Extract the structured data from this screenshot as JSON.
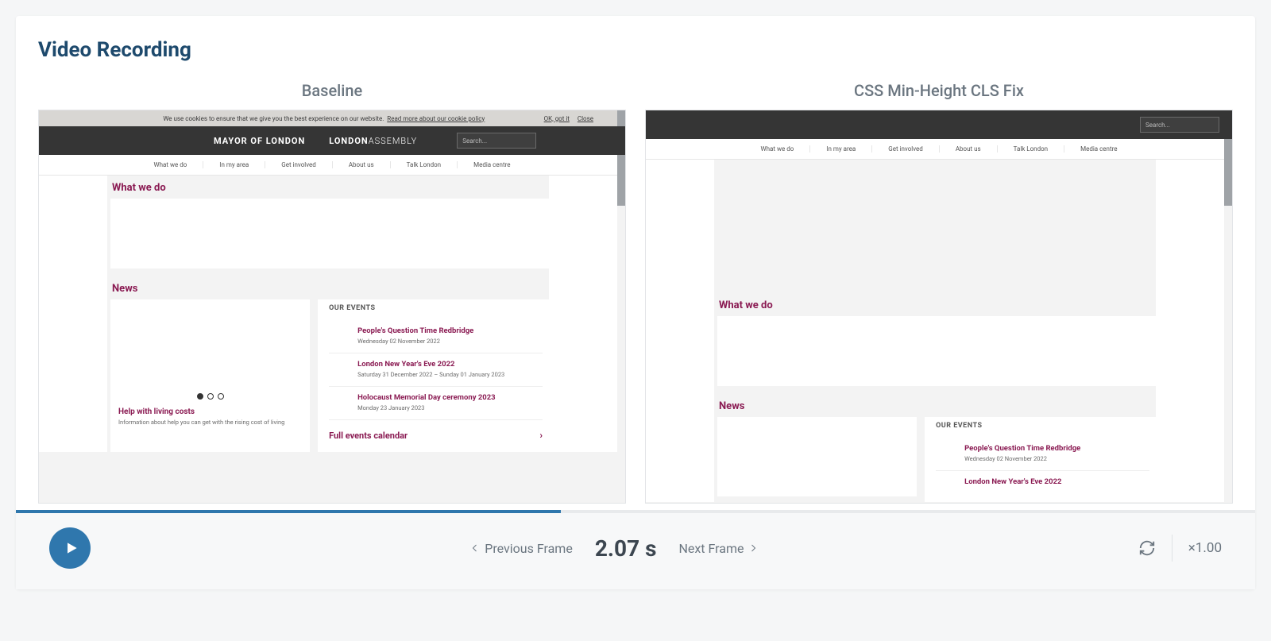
{
  "title": "Video Recording",
  "compare": {
    "baseline_label": "Baseline",
    "fix_label": "CSS Min-Height CLS Fix"
  },
  "site": {
    "cookie": {
      "text": "We use cookies to ensure that we give you the best experience on our website.",
      "link": "Read more about our cookie policy",
      "ok": "OK, got it",
      "close": "Close"
    },
    "brand1": "MAYOR OF LONDON",
    "brand2a": "LONDON",
    "brand2b": "ASSEMBLY",
    "search_placeholder": "Search...",
    "nav": [
      "What we do",
      "In my area",
      "Get involved",
      "About us",
      "Talk London",
      "Media centre"
    ],
    "section_what": "What we do",
    "section_news": "News",
    "news_card": {
      "title": "Help with living costs",
      "desc": "Information about help you can get with the rising cost of living"
    },
    "events_head": "OUR EVENTS",
    "events": [
      {
        "title": "People's Question Time Redbridge",
        "date": "Wednesday 02 November 2022"
      },
      {
        "title": "London New Year's Eve 2022",
        "date": "Saturday 31 December 2022 – Sunday 01 January 2023"
      },
      {
        "title": "Holocaust Memorial Day ceremony 2023",
        "date": "Monday 23 January 2023"
      }
    ],
    "full_calendar": "Full events calendar"
  },
  "controls": {
    "prev": "Previous Frame",
    "next": "Next Frame",
    "time": "2.07 s",
    "speed": "×1.00"
  },
  "progress_percent": 44
}
